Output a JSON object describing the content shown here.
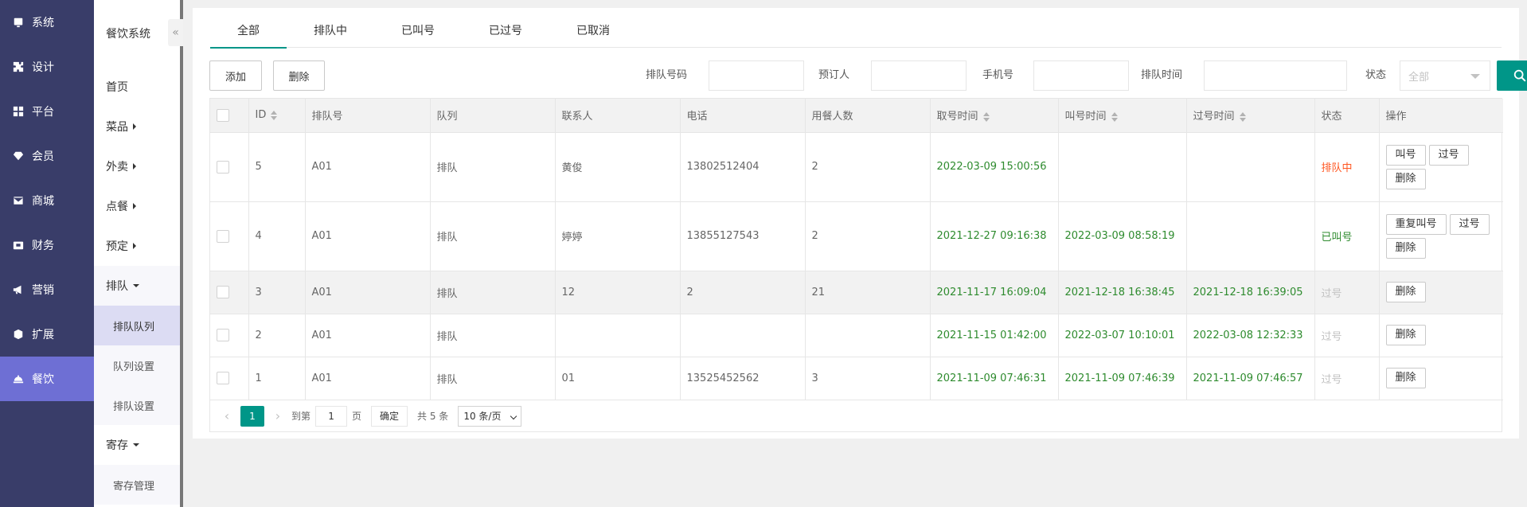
{
  "nav1": [
    {
      "label": "系统",
      "icon": "monitor-icon"
    },
    {
      "label": "设计",
      "icon": "puzzle-icon"
    },
    {
      "label": "平台",
      "icon": "grid-icon"
    },
    {
      "label": "会员",
      "icon": "diamond-icon"
    },
    {
      "label": "商城",
      "icon": "mail-icon"
    },
    {
      "label": "财务",
      "icon": "wallet-icon"
    },
    {
      "label": "营销",
      "icon": "megaphone-icon"
    },
    {
      "label": "扩展",
      "icon": "cube-icon"
    },
    {
      "label": "餐饮",
      "icon": "cloche-icon"
    }
  ],
  "nav2": {
    "title": "餐饮系统",
    "collapse": "«",
    "items": {
      "home": "首页",
      "dishes": "菜品",
      "takeout": "外卖",
      "order": "点餐",
      "reserve": "预定",
      "queue": "排队",
      "queue_list": "排队队列",
      "queue_settings": "队列设置",
      "queue_setup": "排队设置",
      "storage": "寄存",
      "storage_manage": "寄存管理"
    }
  },
  "tabs": [
    "全部",
    "排队中",
    "已叫号",
    "已过号",
    "已取消"
  ],
  "toolbar": {
    "add": "添加",
    "delete": "删除",
    "queue_no_label": "排队号码",
    "booker_label": "预订人",
    "phone_label": "手机号",
    "queue_time_label": "排队时间",
    "status_label": "状态",
    "status_placeholder": "全部"
  },
  "table": {
    "headers": [
      "ID",
      "排队号",
      "队列",
      "联系人",
      "电话",
      "用餐人数",
      "取号时间",
      "叫号时间",
      "过号时间",
      "状态",
      "操作"
    ],
    "rows": [
      {
        "id": "5",
        "no": "A01",
        "queue": "排队",
        "contact": "黄俊",
        "phone": "13802512404",
        "people": "2",
        "take": "2022-03-09 15:00:56",
        "call": "",
        "pass": "",
        "status": "排队中",
        "ops": [
          "叫号",
          "过号",
          "删除"
        ]
      },
      {
        "id": "4",
        "no": "A01",
        "queue": "排队",
        "contact": "婷婷",
        "phone": "13855127543",
        "people": "2",
        "take": "2021-12-27 09:16:38",
        "call": "2022-03-09 08:58:19",
        "pass": "",
        "status": "已叫号",
        "ops": [
          "重复叫号",
          "过号",
          "删除"
        ]
      },
      {
        "id": "3",
        "no": "A01",
        "queue": "排队",
        "contact": "12",
        "phone": "2",
        "people": "21",
        "take": "2021-11-17 16:09:04",
        "call": "2021-12-18 16:38:45",
        "pass": "2021-12-18 16:39:05",
        "status": "过号",
        "ops": [
          "删除"
        ]
      },
      {
        "id": "2",
        "no": "A01",
        "queue": "排队",
        "contact": "",
        "phone": "",
        "people": "",
        "take": "2021-11-15 01:42:00",
        "call": "2022-03-07 10:10:01",
        "pass": "2022-03-08 12:32:33",
        "status": "过号",
        "ops": [
          "删除"
        ]
      },
      {
        "id": "1",
        "no": "A01",
        "queue": "排队",
        "contact": "01",
        "phone": "13525452562",
        "people": "3",
        "take": "2021-11-09 07:46:31",
        "call": "2021-11-09 07:46:39",
        "pass": "2021-11-09 07:46:57",
        "status": "过号",
        "ops": [
          "删除"
        ]
      }
    ]
  },
  "pager": {
    "current": "1",
    "goto_label": "到第",
    "goto_value": "1",
    "page_unit": "页",
    "confirm": "确定",
    "total": "共 5 条",
    "per_page": "10 条/页"
  },
  "colors": {
    "accent": "#009688",
    "nav_bg": "#393d69",
    "nav_active": "#6e6fd4",
    "status_queue": "#ff5722",
    "status_called": "#2e8b2e",
    "status_passed": "#c2c2c2"
  }
}
